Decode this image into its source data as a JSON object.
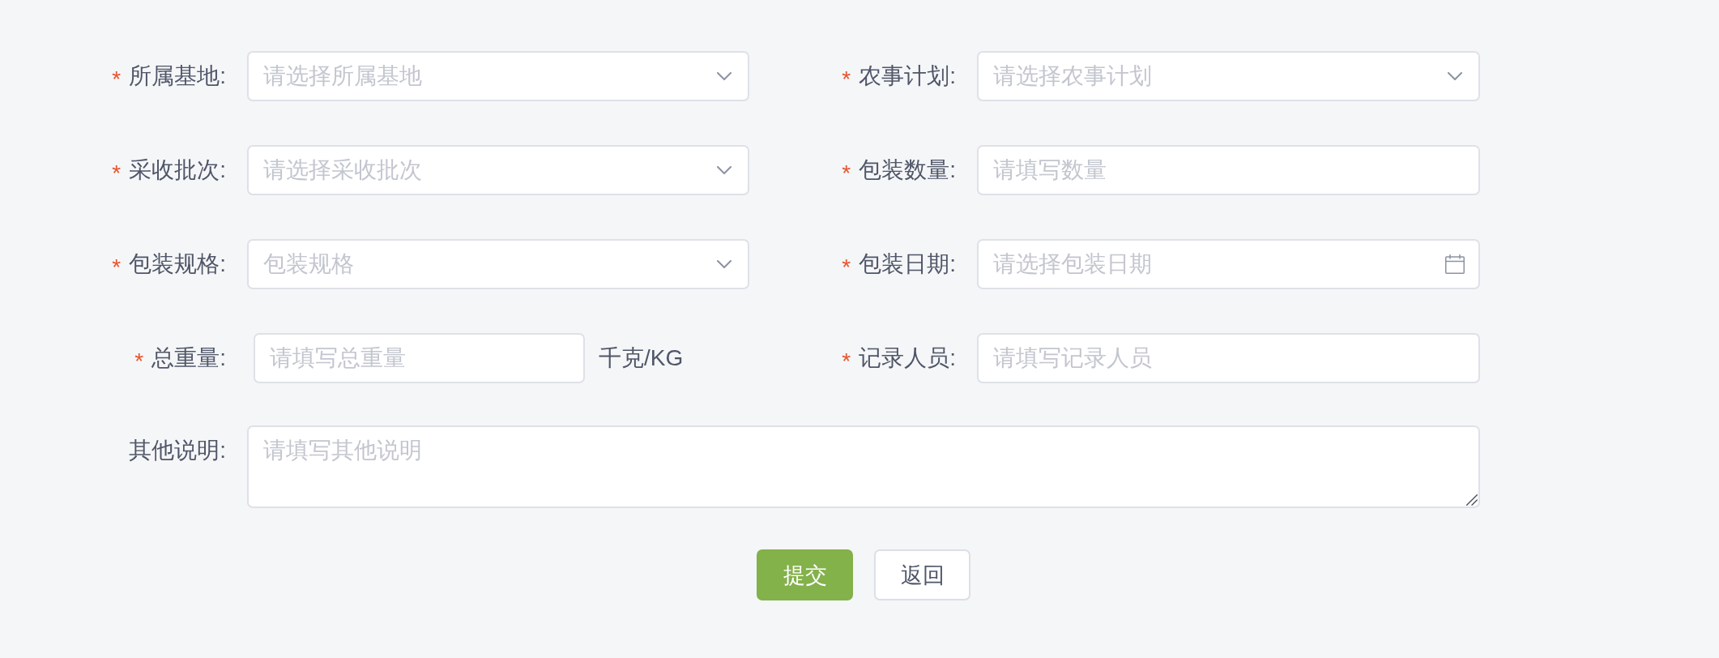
{
  "form": {
    "fields": [
      {
        "kind": "select",
        "required_mark": "*",
        "label": "所属基地:",
        "placeholder": "请选择所属基地"
      },
      {
        "kind": "select",
        "required_mark": "*",
        "label": "农事计划:",
        "placeholder": "请选择农事计划"
      },
      {
        "kind": "select",
        "required_mark": "*",
        "label": "采收批次:",
        "placeholder": "请选择采收批次"
      },
      {
        "kind": "input",
        "required_mark": "*",
        "label": "包装数量:",
        "placeholder": "请填写数量"
      },
      {
        "kind": "select",
        "required_mark": "*",
        "label": "包装规格:",
        "placeholder": "包装规格"
      },
      {
        "kind": "date",
        "required_mark": "*",
        "label": "包装日期:",
        "placeholder": "请选择包装日期"
      },
      {
        "kind": "input",
        "required_mark": "*",
        "label": "总重量:",
        "placeholder": "请填写总重量",
        "unit": "千克/KG"
      },
      {
        "kind": "input",
        "required_mark": "*",
        "label": "记录人员:",
        "placeholder": "请填写记录人员"
      },
      {
        "kind": "textarea",
        "label": "其他说明:",
        "placeholder": "请填写其他说明"
      }
    ]
  },
  "buttons": [
    {
      "kind": "primary",
      "label": "提交"
    },
    {
      "kind": "default",
      "label": "返回"
    }
  ]
}
